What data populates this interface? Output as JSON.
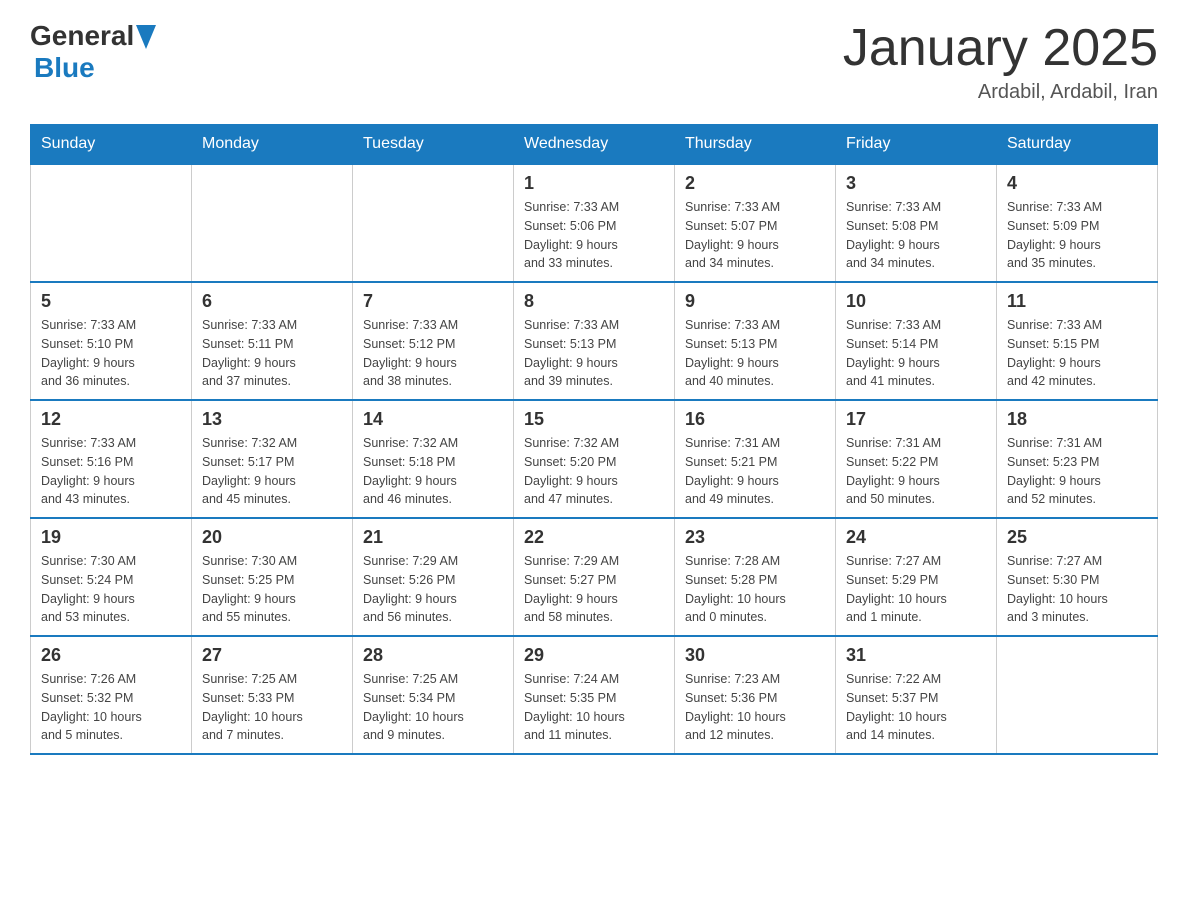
{
  "header": {
    "logo_general": "General",
    "logo_blue": "Blue",
    "month_year": "January 2025",
    "location": "Ardabil, Ardabil, Iran"
  },
  "days_of_week": [
    "Sunday",
    "Monday",
    "Tuesday",
    "Wednesday",
    "Thursday",
    "Friday",
    "Saturday"
  ],
  "weeks": [
    [
      {
        "day": "",
        "info": ""
      },
      {
        "day": "",
        "info": ""
      },
      {
        "day": "",
        "info": ""
      },
      {
        "day": "1",
        "info": "Sunrise: 7:33 AM\nSunset: 5:06 PM\nDaylight: 9 hours\nand 33 minutes."
      },
      {
        "day": "2",
        "info": "Sunrise: 7:33 AM\nSunset: 5:07 PM\nDaylight: 9 hours\nand 34 minutes."
      },
      {
        "day": "3",
        "info": "Sunrise: 7:33 AM\nSunset: 5:08 PM\nDaylight: 9 hours\nand 34 minutes."
      },
      {
        "day": "4",
        "info": "Sunrise: 7:33 AM\nSunset: 5:09 PM\nDaylight: 9 hours\nand 35 minutes."
      }
    ],
    [
      {
        "day": "5",
        "info": "Sunrise: 7:33 AM\nSunset: 5:10 PM\nDaylight: 9 hours\nand 36 minutes."
      },
      {
        "day": "6",
        "info": "Sunrise: 7:33 AM\nSunset: 5:11 PM\nDaylight: 9 hours\nand 37 minutes."
      },
      {
        "day": "7",
        "info": "Sunrise: 7:33 AM\nSunset: 5:12 PM\nDaylight: 9 hours\nand 38 minutes."
      },
      {
        "day": "8",
        "info": "Sunrise: 7:33 AM\nSunset: 5:13 PM\nDaylight: 9 hours\nand 39 minutes."
      },
      {
        "day": "9",
        "info": "Sunrise: 7:33 AM\nSunset: 5:13 PM\nDaylight: 9 hours\nand 40 minutes."
      },
      {
        "day": "10",
        "info": "Sunrise: 7:33 AM\nSunset: 5:14 PM\nDaylight: 9 hours\nand 41 minutes."
      },
      {
        "day": "11",
        "info": "Sunrise: 7:33 AM\nSunset: 5:15 PM\nDaylight: 9 hours\nand 42 minutes."
      }
    ],
    [
      {
        "day": "12",
        "info": "Sunrise: 7:33 AM\nSunset: 5:16 PM\nDaylight: 9 hours\nand 43 minutes."
      },
      {
        "day": "13",
        "info": "Sunrise: 7:32 AM\nSunset: 5:17 PM\nDaylight: 9 hours\nand 45 minutes."
      },
      {
        "day": "14",
        "info": "Sunrise: 7:32 AM\nSunset: 5:18 PM\nDaylight: 9 hours\nand 46 minutes."
      },
      {
        "day": "15",
        "info": "Sunrise: 7:32 AM\nSunset: 5:20 PM\nDaylight: 9 hours\nand 47 minutes."
      },
      {
        "day": "16",
        "info": "Sunrise: 7:31 AM\nSunset: 5:21 PM\nDaylight: 9 hours\nand 49 minutes."
      },
      {
        "day": "17",
        "info": "Sunrise: 7:31 AM\nSunset: 5:22 PM\nDaylight: 9 hours\nand 50 minutes."
      },
      {
        "day": "18",
        "info": "Sunrise: 7:31 AM\nSunset: 5:23 PM\nDaylight: 9 hours\nand 52 minutes."
      }
    ],
    [
      {
        "day": "19",
        "info": "Sunrise: 7:30 AM\nSunset: 5:24 PM\nDaylight: 9 hours\nand 53 minutes."
      },
      {
        "day": "20",
        "info": "Sunrise: 7:30 AM\nSunset: 5:25 PM\nDaylight: 9 hours\nand 55 minutes."
      },
      {
        "day": "21",
        "info": "Sunrise: 7:29 AM\nSunset: 5:26 PM\nDaylight: 9 hours\nand 56 minutes."
      },
      {
        "day": "22",
        "info": "Sunrise: 7:29 AM\nSunset: 5:27 PM\nDaylight: 9 hours\nand 58 minutes."
      },
      {
        "day": "23",
        "info": "Sunrise: 7:28 AM\nSunset: 5:28 PM\nDaylight: 10 hours\nand 0 minutes."
      },
      {
        "day": "24",
        "info": "Sunrise: 7:27 AM\nSunset: 5:29 PM\nDaylight: 10 hours\nand 1 minute."
      },
      {
        "day": "25",
        "info": "Sunrise: 7:27 AM\nSunset: 5:30 PM\nDaylight: 10 hours\nand 3 minutes."
      }
    ],
    [
      {
        "day": "26",
        "info": "Sunrise: 7:26 AM\nSunset: 5:32 PM\nDaylight: 10 hours\nand 5 minutes."
      },
      {
        "day": "27",
        "info": "Sunrise: 7:25 AM\nSunset: 5:33 PM\nDaylight: 10 hours\nand 7 minutes."
      },
      {
        "day": "28",
        "info": "Sunrise: 7:25 AM\nSunset: 5:34 PM\nDaylight: 10 hours\nand 9 minutes."
      },
      {
        "day": "29",
        "info": "Sunrise: 7:24 AM\nSunset: 5:35 PM\nDaylight: 10 hours\nand 11 minutes."
      },
      {
        "day": "30",
        "info": "Sunrise: 7:23 AM\nSunset: 5:36 PM\nDaylight: 10 hours\nand 12 minutes."
      },
      {
        "day": "31",
        "info": "Sunrise: 7:22 AM\nSunset: 5:37 PM\nDaylight: 10 hours\nand 14 minutes."
      },
      {
        "day": "",
        "info": ""
      }
    ]
  ]
}
